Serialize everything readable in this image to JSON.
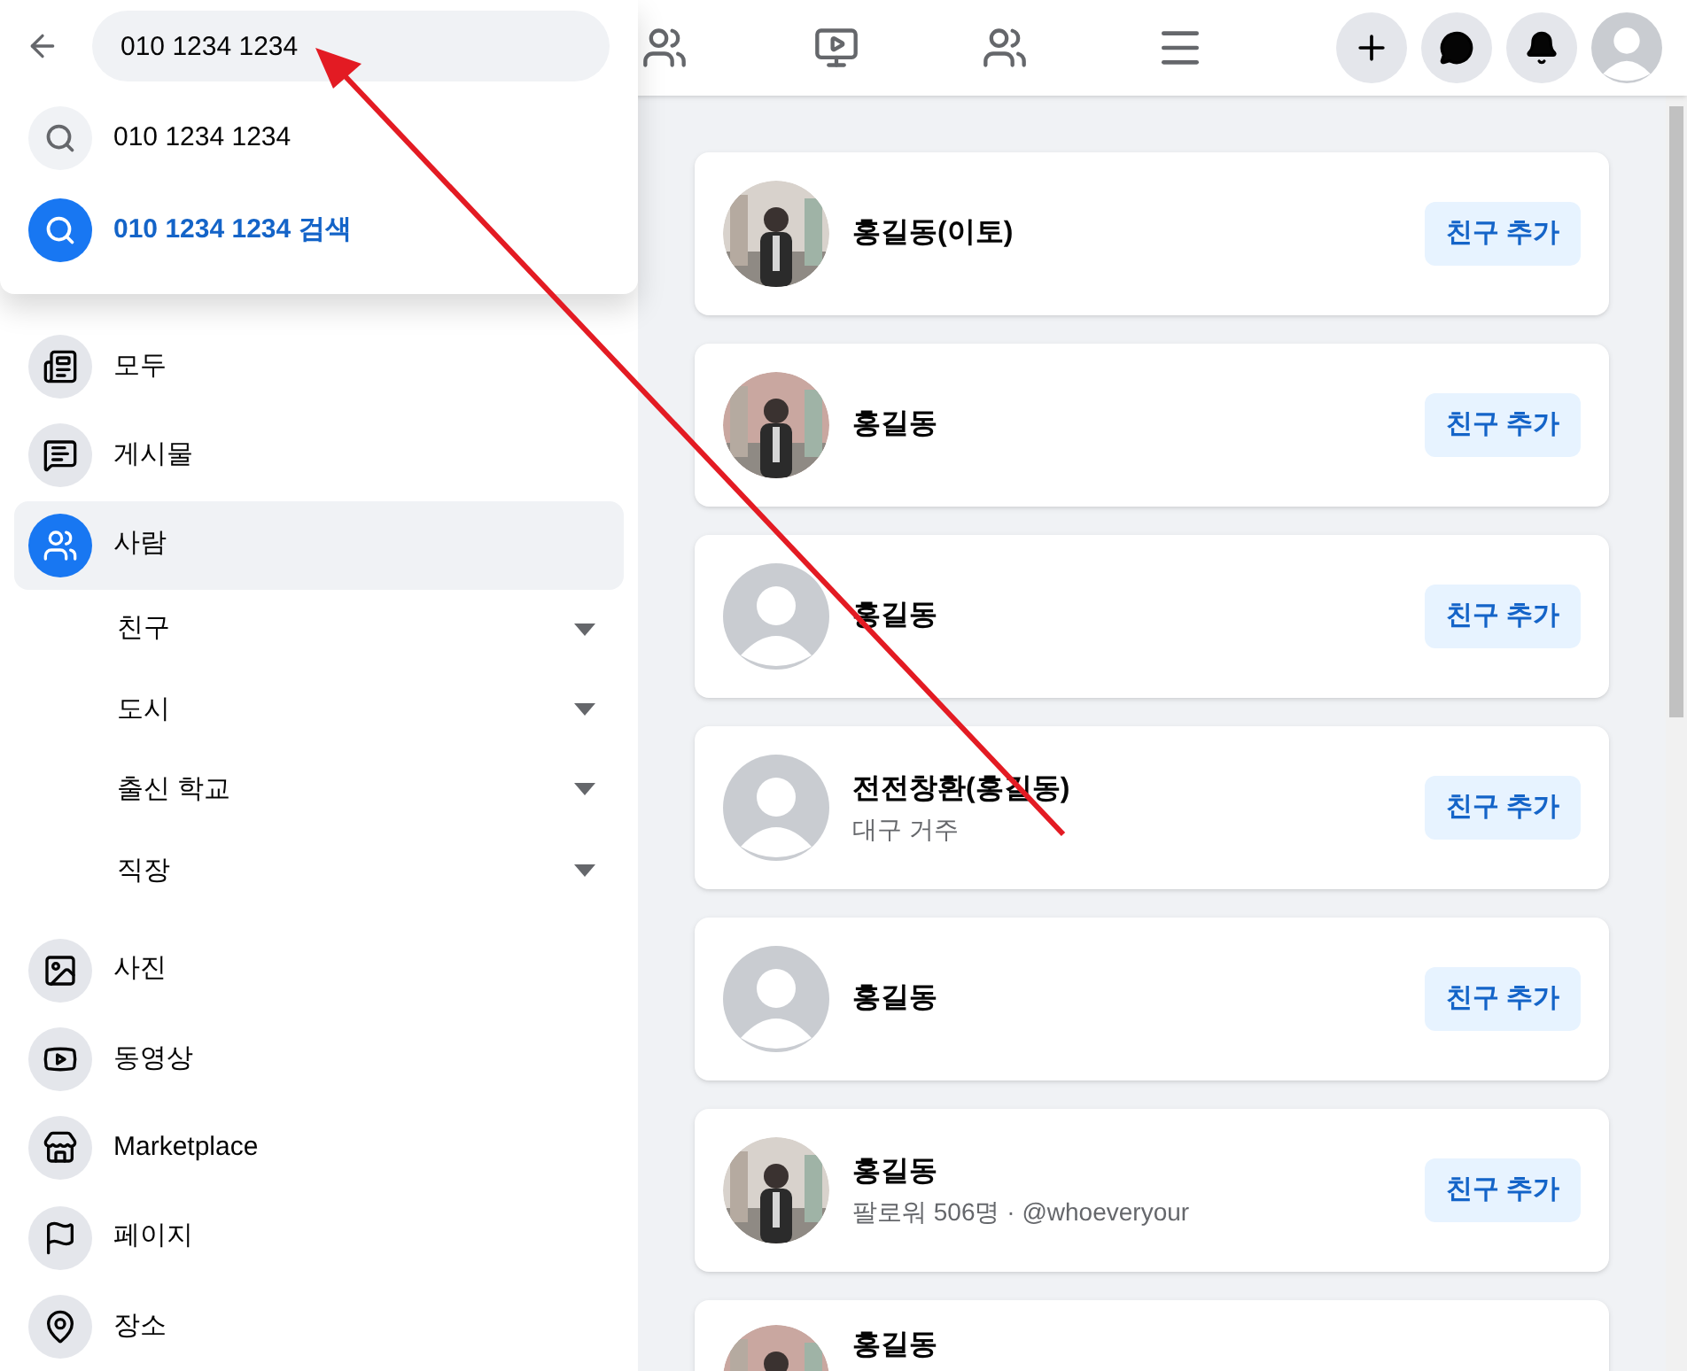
{
  "search": {
    "value": "010 1234 1234",
    "suggestions": [
      {
        "kind": "recent",
        "text": "010 1234 1234"
      },
      {
        "kind": "search",
        "text": "010 1234 1234 검색"
      }
    ]
  },
  "sidebar": {
    "items": [
      {
        "kind": "main",
        "label": "모두",
        "selected": false
      },
      {
        "kind": "main",
        "label": "게시물",
        "selected": false
      },
      {
        "kind": "main",
        "label": "사람",
        "selected": true
      },
      {
        "kind": "sub",
        "label": "친구",
        "selected": false
      },
      {
        "kind": "sub",
        "label": "도시",
        "selected": false
      },
      {
        "kind": "sub",
        "label": "출신 학교",
        "selected": false
      },
      {
        "kind": "sub",
        "label": "직장",
        "selected": false
      },
      {
        "kind": "main",
        "label": "사진",
        "selected": false
      },
      {
        "kind": "main",
        "label": "동영상",
        "selected": false
      },
      {
        "kind": "main",
        "label": "Marketplace",
        "selected": false
      },
      {
        "kind": "main",
        "label": "페이지",
        "selected": false
      },
      {
        "kind": "main",
        "label": "장소",
        "selected": false
      }
    ]
  },
  "results": [
    {
      "kind": "picture",
      "name": "홍길동(이토)",
      "button": "친구 추가"
    },
    {
      "kind": "picture",
      "name": "홍길동",
      "button": "친구 추가"
    },
    {
      "name": "홍길동",
      "button": "친구 추가"
    },
    {
      "name": "전전창환(홍길동)",
      "detail": "대구 거주",
      "button": "친구 추가"
    },
    {
      "name": "홍길동",
      "button": "친구 추가"
    },
    {
      "kind": "picture",
      "name": "홍길동",
      "detail": "팔로워 506명 · @whoeveryour",
      "button": "친구 추가"
    },
    {
      "kind": "picture",
      "name": "홍길동"
    }
  ]
}
